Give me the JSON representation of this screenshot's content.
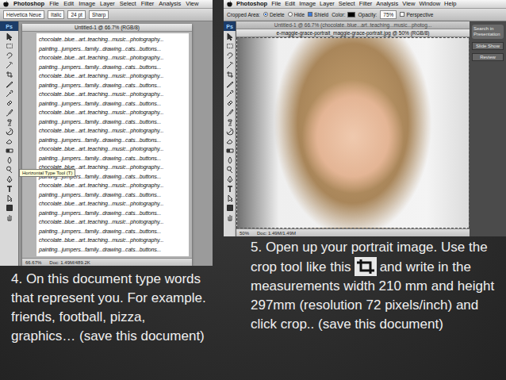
{
  "left_screenshot": {
    "app_badge": "Ps",
    "menu": [
      "Photoshop",
      "File",
      "Edit",
      "Image",
      "Layer",
      "Select",
      "Filter",
      "Analysis",
      "View"
    ],
    "options": [
      "Helvetica Neue",
      "Italic",
      "24 pt",
      "Sharp"
    ],
    "document": {
      "title": "Untitled-1 @ 66.7% (RGB/8)",
      "lines": [
        "chocolate..blue...art..teaching...music...photography...",
        "painting...jumpers...family...drawing...cats...buttons...",
        "chocolate..blue...art..teaching...music...photography...",
        "painting...jumpers...family...drawing...cats...buttons...",
        "chocolate..blue...art..teaching...music...photography...",
        "painting...jumpers...family...drawing...cats...buttons...",
        "chocolate..blue...art..teaching...music...photography...",
        "painting...jumpers...family...drawing...cats...buttons...",
        "chocolate..blue...art..teaching...music...photography...",
        "painting...jumpers...family...drawing...cats...buttons...",
        "chocolate..blue...art..teaching...music...photography...",
        "painting...jumpers...family...drawing...cats...buttons...",
        "chocolate..blue...art..teaching...music...photography...",
        "painting...jumpers...family...drawing...cats...buttons...",
        "chocolate..blue...art..teaching...music...photography...",
        "painting...jumpers...family...drawing...cats...buttons...",
        "chocolate..blue...art..teaching...music...photography...",
        "painting...jumpers...family...drawing...cats...buttons...",
        "chocolate..blue...art..teaching...music...photography...",
        "painting...jumpers...family...drawing...cats...buttons...",
        "chocolate..blue...art..teaching...music...photography...",
        "painting...jumpers...family...drawing...cats...buttons...",
        "chocolate..blue...art..teaching...music...photography...",
        "painting...jumpers...family...drawing...cats...buttons..."
      ]
    },
    "tooltip": "Horizontal Type Tool (T)",
    "status": {
      "zoom": "66.67%",
      "info": "Doc: 1.49M/489.2K"
    }
  },
  "left_caption": "4. On this document type words that represent you. For example. friends, football, pizza, graphics… (save this document)",
  "right_screenshot": {
    "app_badge": "Ps",
    "menu": [
      "Photoshop",
      "File",
      "Edit",
      "Image",
      "Layer",
      "Select",
      "Filter",
      "Analysis",
      "View",
      "Window",
      "Help"
    ],
    "options": [
      {
        "label": "Cropped Area:",
        "kind": "label"
      },
      {
        "label": "Delete",
        "kind": "radio",
        "selected": true
      },
      {
        "label": "Hide",
        "kind": "radio",
        "selected": false
      },
      {
        "label": "Shield",
        "kind": "checkbox",
        "checked": true
      },
      {
        "label": "Color:",
        "kind": "swatch",
        "color": "#000000"
      },
      {
        "label": "Opacity:",
        "kind": "label"
      },
      {
        "label": "75%",
        "kind": "field"
      },
      {
        "label": "Perspective",
        "kind": "checkbox",
        "checked": false
      }
    ],
    "tabs": [
      {
        "label": "Untitled-1 @ 66.7% (chocolate..blue...art..teaching...music...photog...",
        "selected": false
      },
      {
        "label": "e-maggie-grace-portrait_maggie-grace-portrait.jpg @ 50% (RGB/8)",
        "selected": true
      }
    ],
    "side_panel": {
      "search": "Search in Presentation",
      "buttons": [
        "Slide Show",
        "Review"
      ]
    },
    "status": {
      "zoom": "50%",
      "info": "Doc: 1.49M/1.49M"
    }
  },
  "right_caption": {
    "before_icon": "5. Open up your portrait image. Use the crop tool like this",
    "after_icon": "and write in the measurements width 210 mm and height 297mm (resolution 72 pixels/inch) and click crop.. (save this document)"
  }
}
